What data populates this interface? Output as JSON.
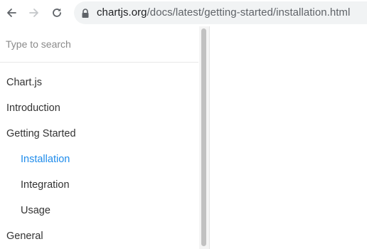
{
  "browser": {
    "url_host": "chartjs.org",
    "url_path": "/docs/latest/getting-started/installation.html",
    "icons": {
      "back": "arrow-left-icon",
      "forward": "arrow-right-icon",
      "reload": "reload-icon",
      "lock": "lock-icon"
    }
  },
  "sidebar": {
    "search_placeholder": "Type to search",
    "items": [
      {
        "label": "Chart.js",
        "level": 0,
        "active": false
      },
      {
        "label": "Introduction",
        "level": 0,
        "active": false
      },
      {
        "label": "Getting Started",
        "level": 0,
        "active": false
      },
      {
        "label": "Installation",
        "level": 1,
        "active": true
      },
      {
        "label": "Integration",
        "level": 1,
        "active": false
      },
      {
        "label": "Usage",
        "level": 1,
        "active": false
      },
      {
        "label": "General",
        "level": 0,
        "active": false
      }
    ]
  },
  "colors": {
    "active_link": "#1f8ceb",
    "text": "#333333"
  }
}
